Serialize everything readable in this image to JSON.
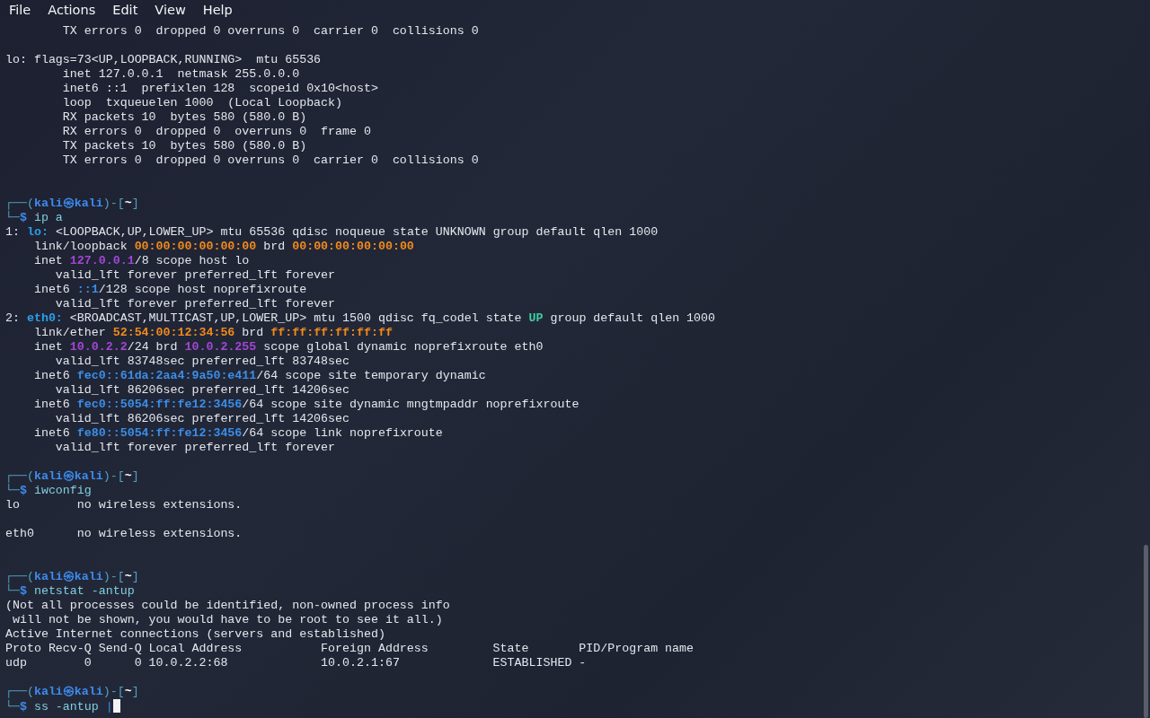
{
  "menu": [
    {
      "label": "File"
    },
    {
      "label": "Actions"
    },
    {
      "label": "Edit"
    },
    {
      "label": "View"
    },
    {
      "label": "Help"
    }
  ],
  "lines": [
    {
      "kind": "output",
      "segments": [
        {
          "text": "        TX errors 0  dropped 0 overruns 0  carrier 0  collisions 0",
          "kind": "plain"
        }
      ]
    },
    {
      "kind": "blank"
    },
    {
      "kind": "output",
      "segments": [
        {
          "text": "lo: flags=73<UP,LOOPBACK,RUNNING>  mtu 65536",
          "kind": "plain"
        }
      ]
    },
    {
      "kind": "output",
      "segments": [
        {
          "text": "        inet 127.0.0.1  netmask 255.0.0.0",
          "kind": "plain"
        }
      ]
    },
    {
      "kind": "output",
      "segments": [
        {
          "text": "        inet6 ::1  prefixlen 128  scopeid 0x10<host>",
          "kind": "plain"
        }
      ]
    },
    {
      "kind": "output",
      "segments": [
        {
          "text": "        loop  txqueuelen 1000  (Local Loopback)",
          "kind": "plain"
        }
      ]
    },
    {
      "kind": "output",
      "segments": [
        {
          "text": "        RX packets 10  bytes 580 (580.0 B)",
          "kind": "plain"
        }
      ]
    },
    {
      "kind": "output",
      "segments": [
        {
          "text": "        RX errors 0  dropped 0  overruns 0  frame 0",
          "kind": "plain"
        }
      ]
    },
    {
      "kind": "output",
      "segments": [
        {
          "text": "        TX packets 10  bytes 580 (580.0 B)",
          "kind": "plain"
        }
      ]
    },
    {
      "kind": "output",
      "segments": [
        {
          "text": "        TX errors 0  dropped 0 overruns 0  carrier 0  collisions 0",
          "kind": "plain"
        }
      ]
    },
    {
      "kind": "blank"
    },
    {
      "kind": "blank"
    },
    {
      "kind": "prompt",
      "segments": [
        {
          "text": "┌──(",
          "kind": "frame"
        },
        {
          "text": "kali㉿kali",
          "kind": "user"
        },
        {
          "text": ")-[",
          "kind": "frame"
        },
        {
          "text": "~",
          "kind": "path"
        },
        {
          "text": "]",
          "kind": "frame"
        }
      ]
    },
    {
      "kind": "command",
      "segments": [
        {
          "text": "└─",
          "kind": "frame"
        },
        {
          "text": "$",
          "kind": "dollar"
        },
        {
          "text": " ip a",
          "kind": "cmd"
        }
      ]
    },
    {
      "kind": "output",
      "segments": [
        {
          "text": "1: ",
          "kind": "plain"
        },
        {
          "text": "lo:",
          "kind": "iface"
        },
        {
          "text": " <LOOPBACK,UP,LOWER_UP> mtu 65536 qdisc noqueue state UNKNOWN group default qlen 1000",
          "kind": "plain"
        }
      ]
    },
    {
      "kind": "output",
      "segments": [
        {
          "text": "    link/loopback ",
          "kind": "plain"
        },
        {
          "text": "00:00:00:00:00:00",
          "kind": "mac"
        },
        {
          "text": " brd ",
          "kind": "plain"
        },
        {
          "text": "00:00:00:00:00:00",
          "kind": "mac"
        }
      ]
    },
    {
      "kind": "output",
      "segments": [
        {
          "text": "    inet ",
          "kind": "plain"
        },
        {
          "text": "127.0.0.1",
          "kind": "ip4"
        },
        {
          "text": "/8 scope host lo",
          "kind": "plain"
        }
      ]
    },
    {
      "kind": "output",
      "segments": [
        {
          "text": "       valid_lft forever preferred_lft forever",
          "kind": "plain"
        }
      ]
    },
    {
      "kind": "output",
      "segments": [
        {
          "text": "    inet6 ",
          "kind": "plain"
        },
        {
          "text": "::1",
          "kind": "ip6"
        },
        {
          "text": "/128 scope host noprefixroute",
          "kind": "plain"
        }
      ]
    },
    {
      "kind": "output",
      "segments": [
        {
          "text": "       valid_lft forever preferred_lft forever",
          "kind": "plain"
        }
      ]
    },
    {
      "kind": "output",
      "segments": [
        {
          "text": "2: ",
          "kind": "plain"
        },
        {
          "text": "eth0:",
          "kind": "iface"
        },
        {
          "text": " <BROADCAST,MULTICAST,UP,LOWER_UP> mtu 1500 qdisc fq_codel state ",
          "kind": "plain"
        },
        {
          "text": "UP",
          "kind": "up"
        },
        {
          "text": " group default qlen 1000",
          "kind": "plain"
        }
      ]
    },
    {
      "kind": "output",
      "segments": [
        {
          "text": "    link/ether ",
          "kind": "plain"
        },
        {
          "text": "52:54:00:12:34:56",
          "kind": "mac"
        },
        {
          "text": " brd ",
          "kind": "plain"
        },
        {
          "text": "ff:ff:ff:ff:ff:ff",
          "kind": "mac"
        }
      ]
    },
    {
      "kind": "output",
      "segments": [
        {
          "text": "    inet ",
          "kind": "plain"
        },
        {
          "text": "10.0.2.2",
          "kind": "ip4"
        },
        {
          "text": "/24 brd ",
          "kind": "plain"
        },
        {
          "text": "10.0.2.255",
          "kind": "ip4"
        },
        {
          "text": " scope global dynamic noprefixroute eth0",
          "kind": "plain"
        }
      ]
    },
    {
      "kind": "output",
      "segments": [
        {
          "text": "       valid_lft 83748sec preferred_lft 83748sec",
          "kind": "plain"
        }
      ]
    },
    {
      "kind": "output",
      "segments": [
        {
          "text": "    inet6 ",
          "kind": "plain"
        },
        {
          "text": "fec0::61da:2aa4:9a50:e411",
          "kind": "ip6"
        },
        {
          "text": "/64 scope site temporary dynamic",
          "kind": "plain"
        }
      ]
    },
    {
      "kind": "output",
      "segments": [
        {
          "text": "       valid_lft 86206sec preferred_lft 14206sec",
          "kind": "plain"
        }
      ]
    },
    {
      "kind": "output",
      "segments": [
        {
          "text": "    inet6 ",
          "kind": "plain"
        },
        {
          "text": "fec0::5054:ff:fe12:3456",
          "kind": "ip6"
        },
        {
          "text": "/64 scope site dynamic mngtmpaddr noprefixroute",
          "kind": "plain"
        }
      ]
    },
    {
      "kind": "output",
      "segments": [
        {
          "text": "       valid_lft 86206sec preferred_lft 14206sec",
          "kind": "plain"
        }
      ]
    },
    {
      "kind": "output",
      "segments": [
        {
          "text": "    inet6 ",
          "kind": "plain"
        },
        {
          "text": "fe80::5054:ff:fe12:3456",
          "kind": "ip6"
        },
        {
          "text": "/64 scope link noprefixroute",
          "kind": "plain"
        }
      ]
    },
    {
      "kind": "output",
      "segments": [
        {
          "text": "       valid_lft forever preferred_lft forever",
          "kind": "plain"
        }
      ]
    },
    {
      "kind": "blank"
    },
    {
      "kind": "prompt",
      "segments": [
        {
          "text": "┌──(",
          "kind": "frame"
        },
        {
          "text": "kali㉿kali",
          "kind": "user"
        },
        {
          "text": ")-[",
          "kind": "frame"
        },
        {
          "text": "~",
          "kind": "path"
        },
        {
          "text": "]",
          "kind": "frame"
        }
      ]
    },
    {
      "kind": "command",
      "segments": [
        {
          "text": "└─",
          "kind": "frame"
        },
        {
          "text": "$",
          "kind": "dollar"
        },
        {
          "text": " iwconfig",
          "kind": "cmd"
        }
      ]
    },
    {
      "kind": "output",
      "segments": [
        {
          "text": "lo        no wireless extensions.",
          "kind": "plain"
        }
      ]
    },
    {
      "kind": "blank"
    },
    {
      "kind": "output",
      "segments": [
        {
          "text": "eth0      no wireless extensions.",
          "kind": "plain"
        }
      ]
    },
    {
      "kind": "blank"
    },
    {
      "kind": "blank"
    },
    {
      "kind": "prompt",
      "segments": [
        {
          "text": "┌──(",
          "kind": "frame"
        },
        {
          "text": "kali㉿kali",
          "kind": "user"
        },
        {
          "text": ")-[",
          "kind": "frame"
        },
        {
          "text": "~",
          "kind": "path"
        },
        {
          "text": "]",
          "kind": "frame"
        }
      ]
    },
    {
      "kind": "command",
      "segments": [
        {
          "text": "└─",
          "kind": "frame"
        },
        {
          "text": "$",
          "kind": "dollar"
        },
        {
          "text": " netstat -antup",
          "kind": "cmd"
        }
      ]
    },
    {
      "kind": "output",
      "segments": [
        {
          "text": "(Not all processes could be identified, non-owned process info",
          "kind": "plain"
        }
      ]
    },
    {
      "kind": "output",
      "segments": [
        {
          "text": " will not be shown, you would have to be root to see it all.)",
          "kind": "plain"
        }
      ]
    },
    {
      "kind": "output",
      "segments": [
        {
          "text": "Active Internet connections (servers and established)",
          "kind": "plain"
        }
      ]
    },
    {
      "kind": "output",
      "segments": [
        {
          "text": "Proto Recv-Q Send-Q Local Address           Foreign Address         State       PID/Program name",
          "kind": "plain"
        }
      ]
    },
    {
      "kind": "output",
      "segments": [
        {
          "text": "udp        0      0 10.0.2.2:68             10.0.2.1:67             ESTABLISHED -",
          "kind": "plain"
        }
      ]
    },
    {
      "kind": "blank"
    },
    {
      "kind": "prompt",
      "segments": [
        {
          "text": "┌──(",
          "kind": "frame"
        },
        {
          "text": "kali㉿kali",
          "kind": "user"
        },
        {
          "text": ")-[",
          "kind": "frame"
        },
        {
          "text": "~",
          "kind": "path"
        },
        {
          "text": "]",
          "kind": "frame"
        }
      ]
    },
    {
      "kind": "input",
      "segments": [
        {
          "text": "└─",
          "kind": "frame"
        },
        {
          "text": "$",
          "kind": "dollar"
        },
        {
          "text": " ss -antup ",
          "kind": "cmd"
        },
        {
          "text": "|",
          "kind": "pipe"
        }
      ]
    }
  ]
}
